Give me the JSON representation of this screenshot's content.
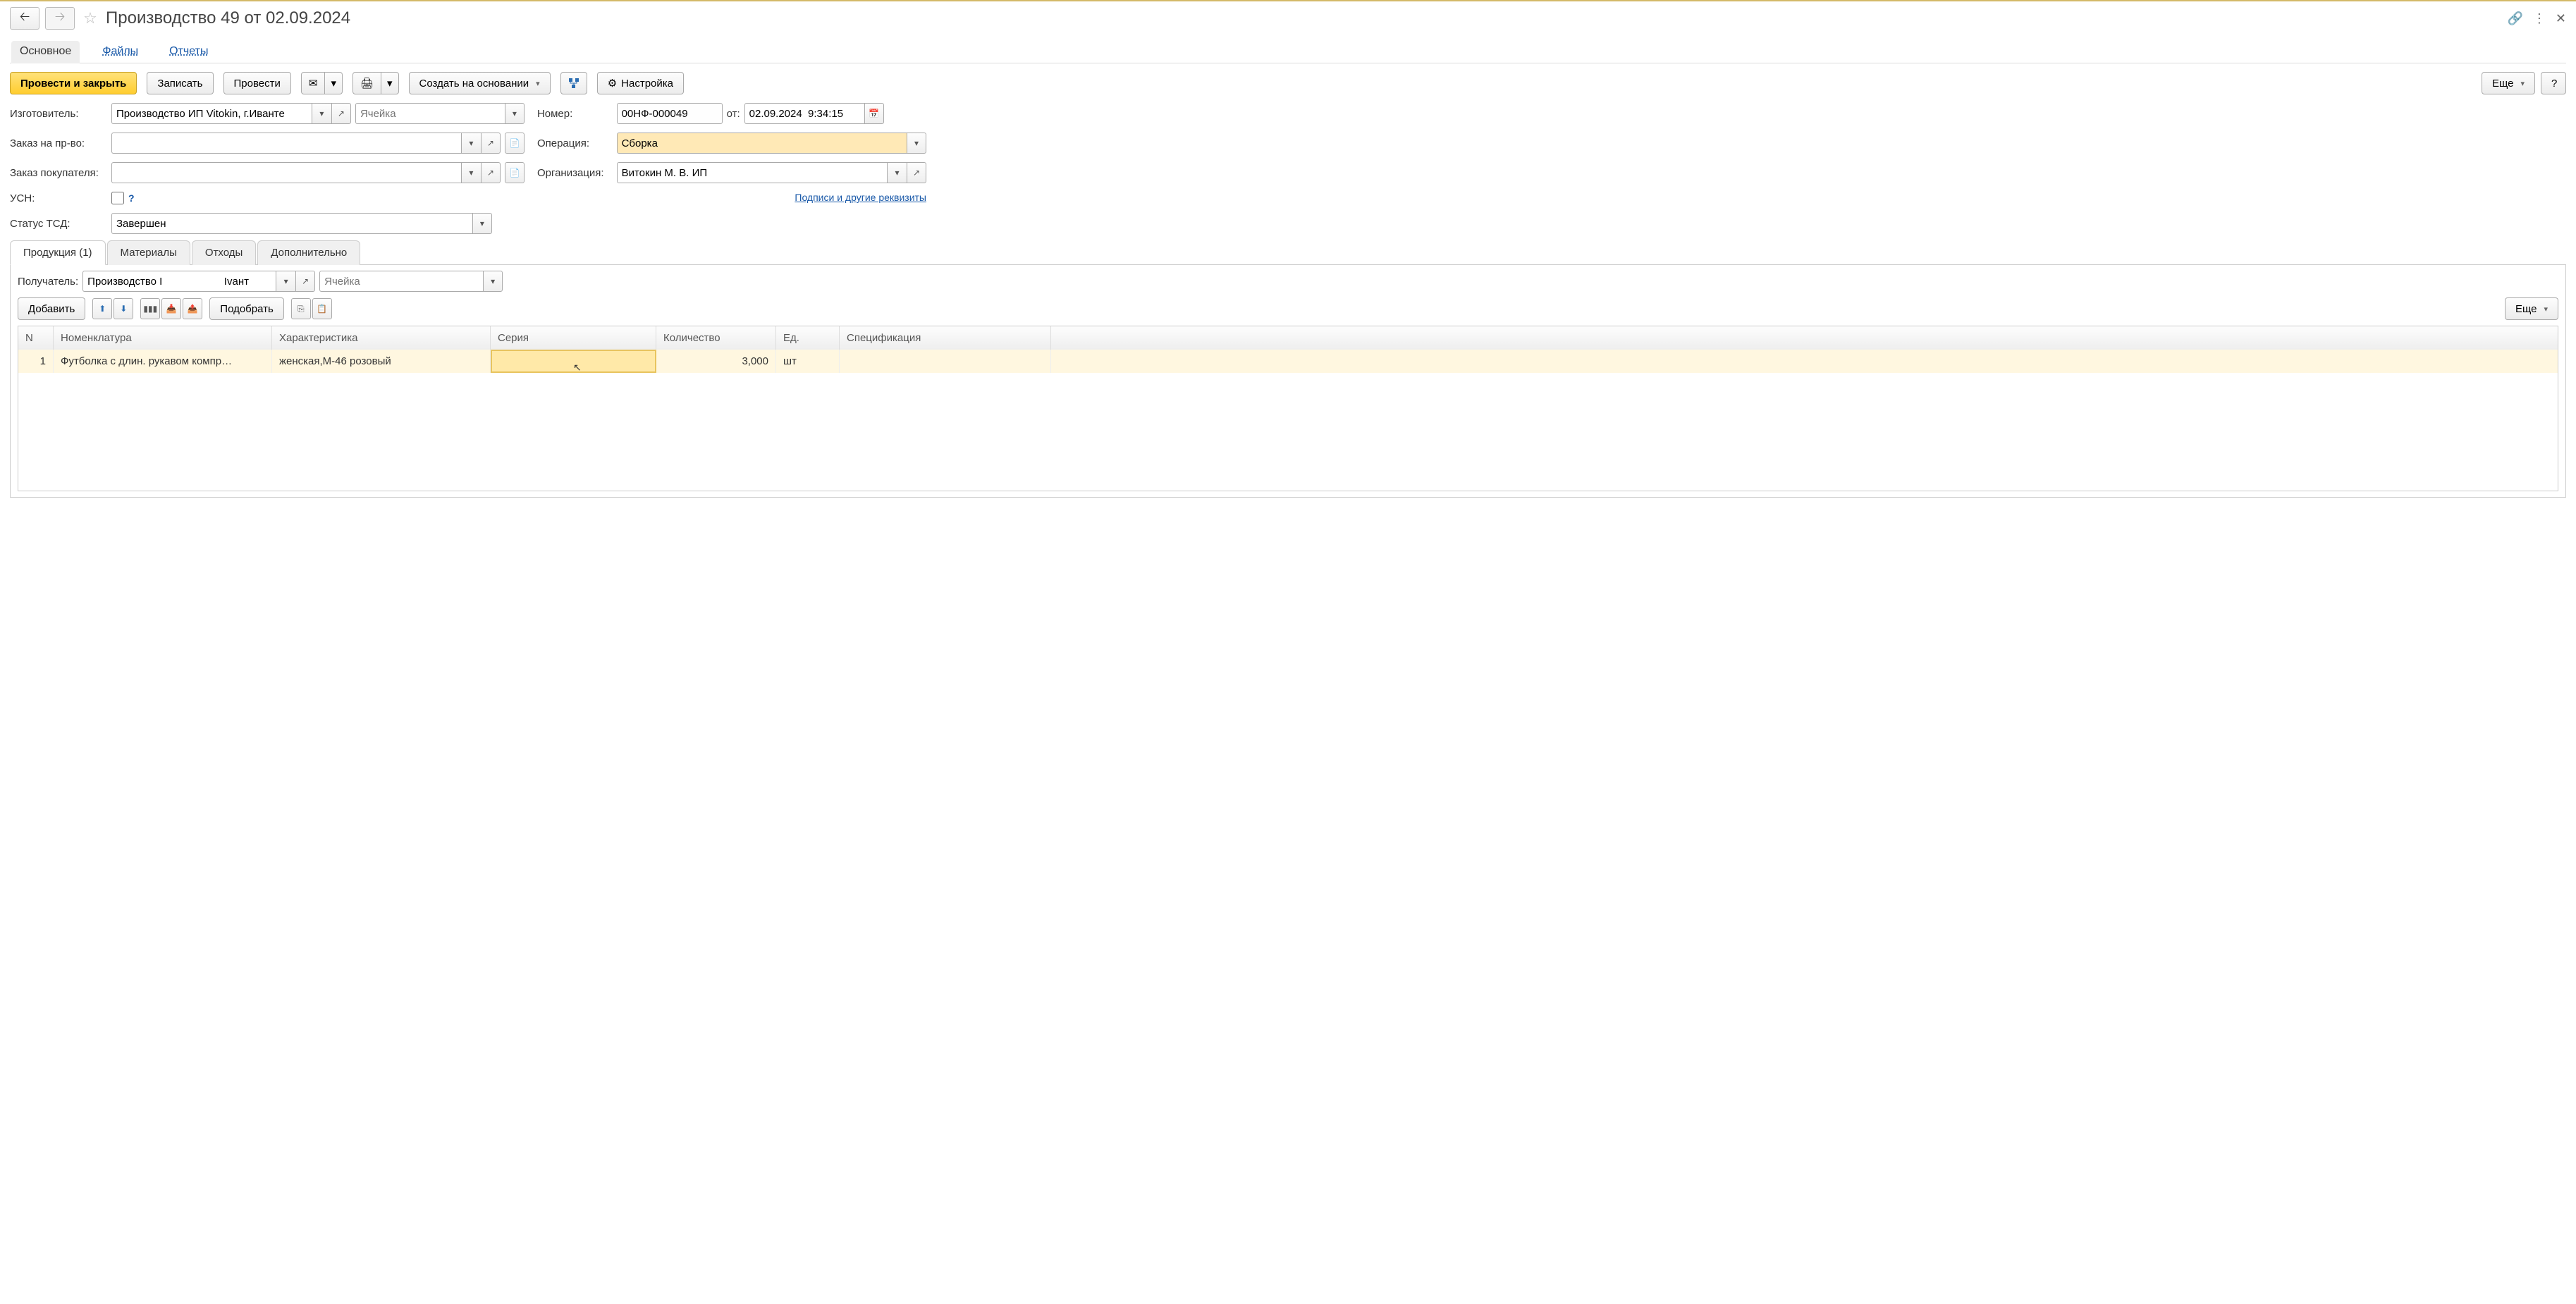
{
  "header": {
    "title": "Производство 49 от 02.09.2024"
  },
  "topnav": {
    "main": "Основное",
    "files": "Файлы",
    "reports": "Отчеты"
  },
  "toolbar": {
    "post_close": "Провести и закрыть",
    "write": "Записать",
    "post": "Провести",
    "create_based": "Создать на основании",
    "settings": "Настройка",
    "more": "Еще",
    "help": "?"
  },
  "form": {
    "manufacturer_label": "Изготовитель:",
    "manufacturer_value": "Производство ИП Vitokin, г.Иванте",
    "cell1_placeholder": "Ячейка",
    "number_label": "Номер:",
    "number_value": "00НФ-000049",
    "from_label": "от:",
    "date_value": "02.09.2024  9:34:15",
    "order_prod_label": "Заказ на пр-во:",
    "operation_label": "Операция:",
    "operation_value": "Сборка",
    "customer_order_label": "Заказ покупателя:",
    "org_label": "Организация:",
    "org_value": "Витокин М. В. ИП",
    "usn_label": "УСН:",
    "signatures_link": "Подписи и другие реквизиты",
    "tsd_label": "Статус ТСД:",
    "tsd_value": "Завершен"
  },
  "tabs": {
    "products": "Продукция (1)",
    "materials": "Материалы",
    "waste": "Отходы",
    "extra": "Дополнительно"
  },
  "panel": {
    "recipient_label": "Получатель:",
    "recipient_value": "Производство I                     Ivант",
    "cell_placeholder": "Ячейка",
    "add": "Добавить",
    "pick": "Подобрать",
    "more": "Еще"
  },
  "table": {
    "headers": {
      "n": "N",
      "nomen": "Номенклатура",
      "char": "Характеристика",
      "series": "Серия",
      "qty": "Количество",
      "unit": "Ед.",
      "spec": "Спецификация"
    },
    "rows": [
      {
        "n": "1",
        "nomen": "Футболка с длин. рукавом компр…",
        "char": "женская,M-46 розовый",
        "series": "",
        "qty": "3,000",
        "unit": "шт",
        "spec": ""
      }
    ]
  }
}
